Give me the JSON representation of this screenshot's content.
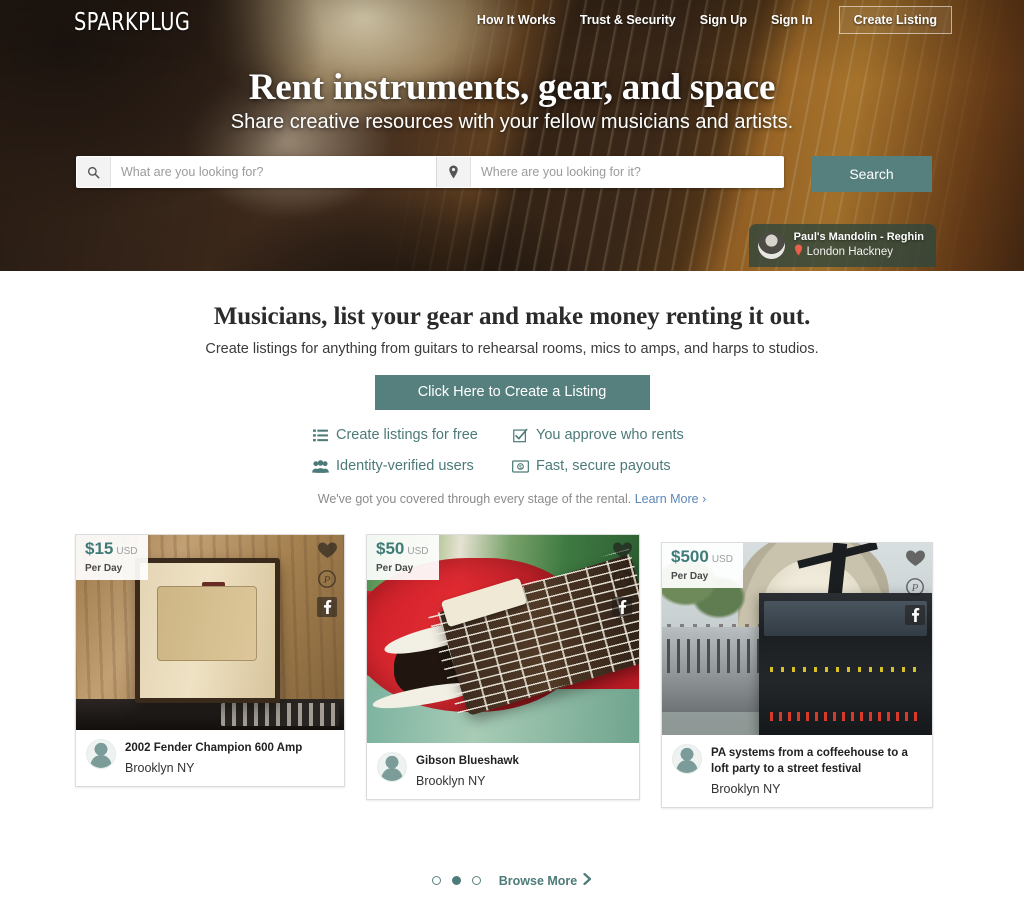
{
  "brand": {
    "logo": "SPARKPLUG",
    "accent": "#56807e",
    "link_blue": "#5b87b8"
  },
  "nav": {
    "items": [
      {
        "label": "How It Works"
      },
      {
        "label": "Trust & Security"
      },
      {
        "label": "Sign Up"
      },
      {
        "label": "Sign In"
      }
    ],
    "cta": "Create Listing"
  },
  "hero": {
    "title": "Rent instruments, gear, and space",
    "subtitle": "Share creative resources with your fellow musicians and artists.",
    "search": {
      "what_placeholder": "What are you looking for?",
      "what_value": "",
      "where_placeholder": "Where are you looking for it?",
      "where_value": "",
      "button": "Search",
      "search_icon": "search-icon",
      "location_icon": "map-pin-icon"
    },
    "featured": {
      "title": "Paul's Mandolin - Reghin",
      "location": "London Hackney",
      "pin_icon": "map-pin-icon"
    }
  },
  "promo": {
    "heading": "Musicians, list your gear and make money renting it out.",
    "lead": "Create listings for anything from guitars to rehearsal rooms, mics to amps, and harps to studios.",
    "cta": "Click Here to Create a Listing",
    "features": [
      {
        "label": "Create listings for free",
        "icon": "list-icon"
      },
      {
        "label": "You approve who rents",
        "icon": "check-square-icon"
      },
      {
        "label": "Identity-verified users",
        "icon": "users-icon"
      },
      {
        "label": "Fast, secure payouts",
        "icon": "money-bill-icon"
      }
    ],
    "covered_text": "We've got you covered through every stage of the rental.",
    "learn_more": "Learn More ›"
  },
  "listings": [
    {
      "price": "$15",
      "currency": "USD",
      "period": "Per Day",
      "title": "2002 Fender Champion 600 Amp",
      "location": "Brooklyn NY",
      "actions": [
        "heart-icon",
        "pinterest-icon",
        "facebook-icon"
      ]
    },
    {
      "price": "$50",
      "currency": "USD",
      "period": "Per Day",
      "title": "Gibson Blueshawk",
      "location": "Brooklyn NY",
      "actions": [
        "heart-icon",
        "pinterest-icon",
        "facebook-icon"
      ]
    },
    {
      "price": "$500",
      "currency": "USD",
      "period": "Per Day",
      "title": "PA systems from a coffeehouse to a loft party to a street festival",
      "location": "Brooklyn NY",
      "actions": [
        "heart-icon",
        "pinterest-icon",
        "facebook-icon"
      ]
    }
  ],
  "pager": {
    "dots": 3,
    "active_index": 1,
    "browse_more": "Browse More",
    "chevron_icon": "chevron-right-icon"
  }
}
